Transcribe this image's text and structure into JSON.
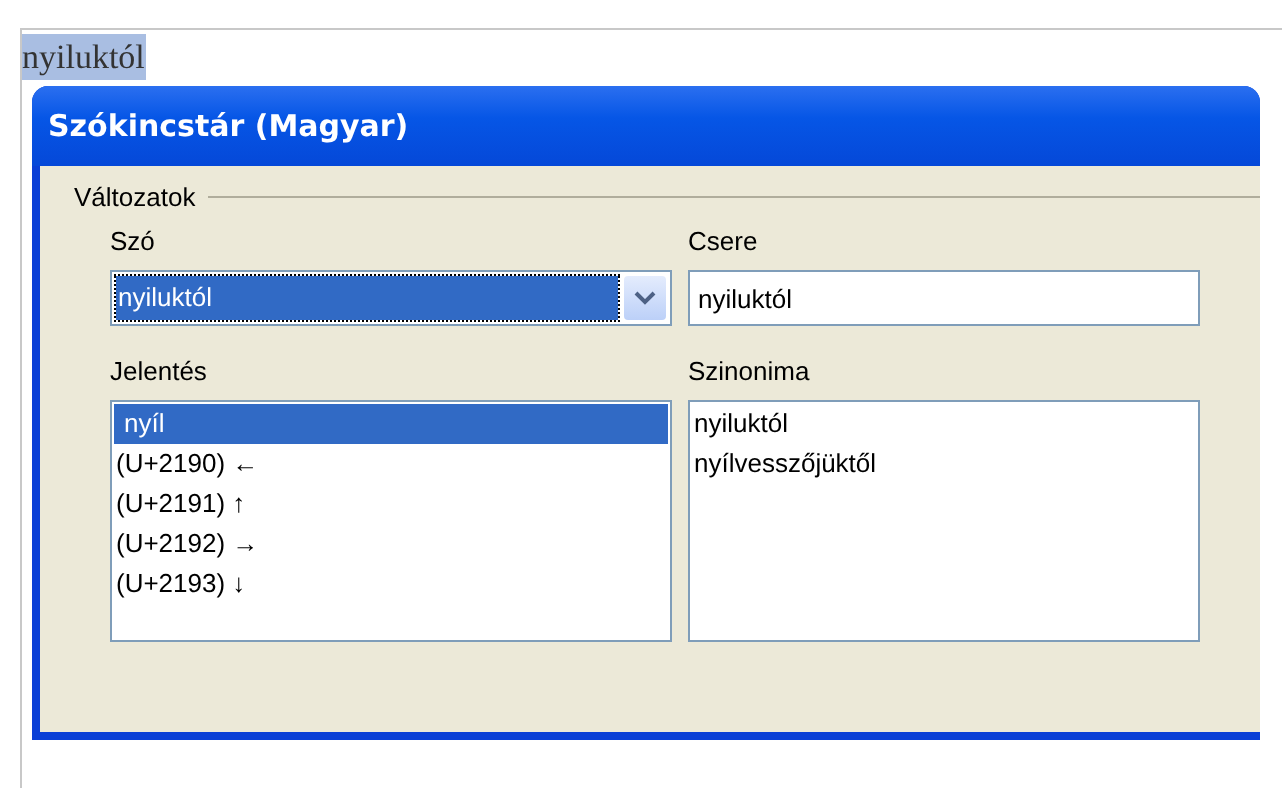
{
  "document": {
    "selected_text": "nyiluktól"
  },
  "dialog": {
    "title": "Szókincstár (Magyar)",
    "group_label": "Változatok",
    "word": {
      "label": "Szó",
      "value": "nyiluktól"
    },
    "replace": {
      "label": "Csere",
      "value": "nyiluktól"
    },
    "meanings": {
      "label": "Jelentés",
      "items": [
        {
          "text": "nyíl",
          "selected": true
        },
        {
          "text": "(U+2190) ←",
          "selected": false
        },
        {
          "text": "(U+2191) ↑",
          "selected": false
        },
        {
          "text": "(U+2192) →",
          "selected": false
        },
        {
          "text": "(U+2193) ↓",
          "selected": false
        }
      ]
    },
    "synonyms": {
      "label": "Szinonima",
      "items": [
        {
          "text": "nyiluktól",
          "selected": false
        },
        {
          "text": "nyílvesszőjüktől",
          "selected": false
        }
      ]
    }
  }
}
